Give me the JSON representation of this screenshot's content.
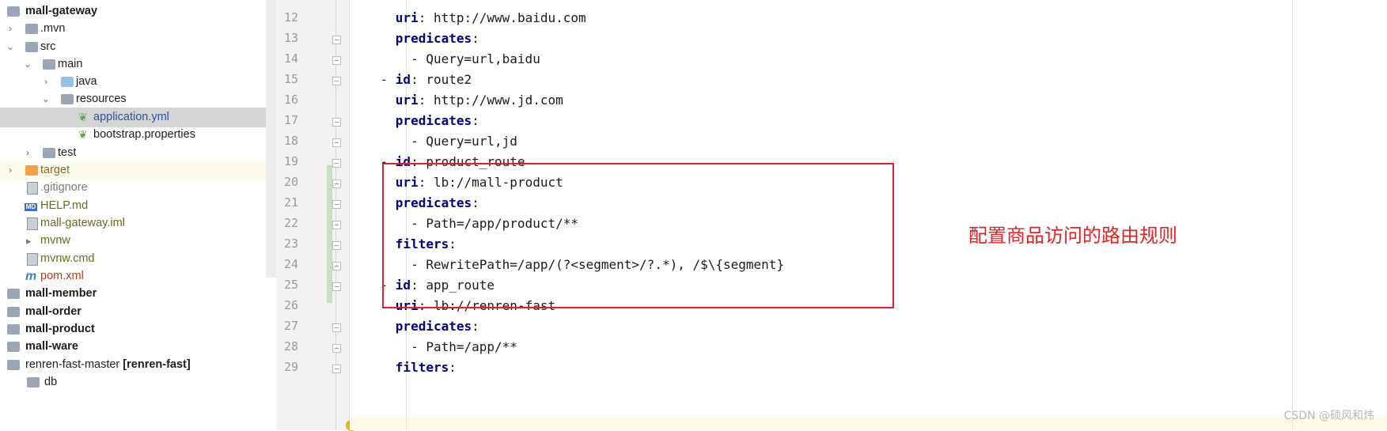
{
  "project_tree": {
    "items": [
      {
        "label": "mall-gateway",
        "kind": "module-open",
        "icon": "module-folder-icon"
      },
      {
        "label": ".mvn",
        "kind": "folder-closed",
        "icon": "folder-icon"
      },
      {
        "label": "src",
        "kind": "folder-open",
        "icon": "folder-icon"
      },
      {
        "label": "main",
        "kind": "folder-open",
        "icon": "folder-icon"
      },
      {
        "label": "java",
        "kind": "folder-closed",
        "icon": "source-folder-icon"
      },
      {
        "label": "resources",
        "kind": "folder-open",
        "icon": "resources-folder-icon"
      },
      {
        "label": "application.yml",
        "kind": "file-selected",
        "icon": "spring-yml-icon"
      },
      {
        "label": "bootstrap.properties",
        "kind": "file",
        "icon": "spring-properties-icon"
      },
      {
        "label": "test",
        "kind": "folder-closed",
        "icon": "folder-icon"
      },
      {
        "label": "target",
        "kind": "folder-closed-excluded",
        "icon": "excluded-folder-icon"
      },
      {
        "label": ".gitignore",
        "kind": "file",
        "icon": "gitignore-icon"
      },
      {
        "label": "HELP.md",
        "kind": "file",
        "icon": "markdown-icon"
      },
      {
        "label": "mall-gateway.iml",
        "kind": "file",
        "icon": "iml-icon"
      },
      {
        "label": "mvnw",
        "kind": "file",
        "icon": "mvnw-icon"
      },
      {
        "label": "mvnw.cmd",
        "kind": "file",
        "icon": "mvnw-cmd-icon"
      },
      {
        "label": "pom.xml",
        "kind": "file",
        "icon": "maven-pom-icon"
      },
      {
        "label": "mall-member",
        "kind": "module",
        "icon": "module-folder-icon"
      },
      {
        "label": "mall-order",
        "kind": "module",
        "icon": "module-folder-icon"
      },
      {
        "label": "mall-product",
        "kind": "module",
        "icon": "module-folder-icon"
      },
      {
        "label": "mall-ware",
        "kind": "module",
        "icon": "module-folder-icon"
      },
      {
        "label": "renren-fast-master",
        "suffix": "[renren-fast]",
        "kind": "module",
        "icon": "module-folder-icon"
      },
      {
        "label": "db",
        "kind": "folder-closed",
        "icon": "folder-icon"
      }
    ]
  },
  "editor": {
    "file": "application.yml",
    "lines": [
      {
        "num": "12",
        "indent": "      ",
        "key": "uri",
        "value": " http://www.baidu.com"
      },
      {
        "num": "13",
        "indent": "      ",
        "key": "predicates",
        "value": ""
      },
      {
        "num": "14",
        "indent": "        ",
        "key": "",
        "value": "- Query=url,baidu"
      },
      {
        "num": "15",
        "indent": "    ",
        "dash": "- ",
        "key": "id",
        "value": " route2"
      },
      {
        "num": "16",
        "indent": "      ",
        "key": "uri",
        "value": " http://www.jd.com"
      },
      {
        "num": "17",
        "indent": "      ",
        "key": "predicates",
        "value": ""
      },
      {
        "num": "18",
        "indent": "        ",
        "key": "",
        "value": "- Query=url,jd"
      },
      {
        "num": "19",
        "indent": "    ",
        "dash": "- ",
        "key": "id",
        "value": " product_route"
      },
      {
        "num": "20",
        "indent": "      ",
        "key": "uri",
        "value": " lb://mall-product"
      },
      {
        "num": "21",
        "indent": "      ",
        "key": "predicates",
        "value": ""
      },
      {
        "num": "22",
        "indent": "        ",
        "key": "",
        "value": "- Path=/app/product/**"
      },
      {
        "num": "23",
        "indent": "      ",
        "key": "filters",
        "value": ""
      },
      {
        "num": "24",
        "indent": "        ",
        "key": "",
        "value": "- RewritePath=/app/(?<segment>/?.*), /$\\{segment}"
      },
      {
        "num": "25",
        "indent": "    ",
        "dash": "- ",
        "key": "id",
        "value": " app_route"
      },
      {
        "num": "26",
        "indent": "      ",
        "key": "uri",
        "value": " lb://renren-fast"
      },
      {
        "num": "27",
        "indent": "      ",
        "key": "predicates",
        "value": ""
      },
      {
        "num": "28",
        "indent": "        ",
        "key": "",
        "value": "- Path=/app/**"
      },
      {
        "num": "29",
        "indent": "      ",
        "key": "filters",
        "value": ""
      }
    ]
  },
  "annotation": {
    "text": "配置商品访问的路由规则",
    "color": "#e02424"
  },
  "watermark": "CSDN @硕风和炜",
  "colors": {
    "yaml_key": "#000080",
    "highlight_box": "#e0202a",
    "selected_row": "#d5d5d5"
  }
}
